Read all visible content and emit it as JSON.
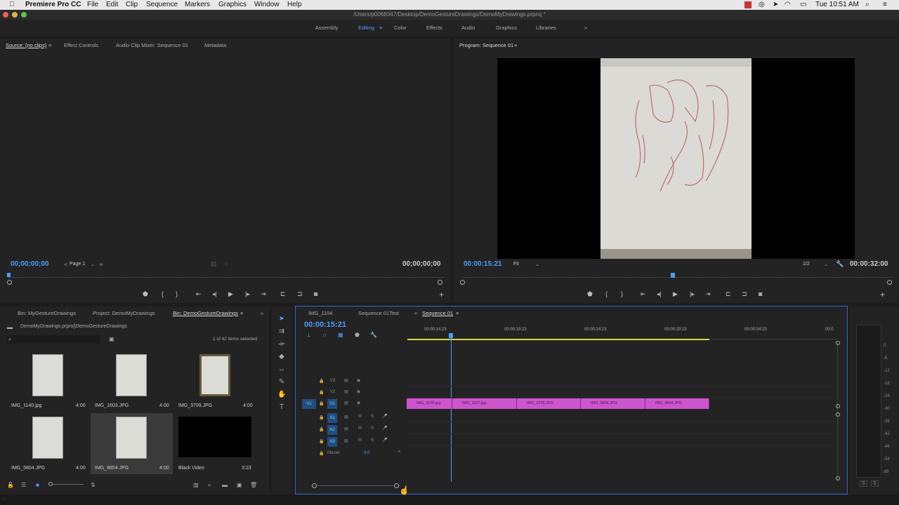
{
  "menubar": {
    "app": "Premiere Pro CC",
    "items": [
      "File",
      "Edit",
      "Clip",
      "Sequence",
      "Markers",
      "Graphics",
      "Window",
      "Help"
    ],
    "clock": "Tue 10:51 AM"
  },
  "titlebar": {
    "path": "/Users/p0068347/Desktop/DemoGestureDrawings/DemoMyDrawings.prproj *"
  },
  "workspaces": [
    "Assembly",
    "Editing",
    "Color",
    "Effects",
    "Audio",
    "Graphics",
    "Libraries"
  ],
  "source": {
    "tabs": [
      "Source: (no clips)",
      "Effect Controls",
      "Audio Clip Mixer: Sequence 01",
      "Metadata"
    ],
    "timecode_in": "00;00;00;00",
    "page": "Page 1",
    "timecode_out": "00;00;00;00"
  },
  "program": {
    "title": "Program: Sequence 01",
    "timecode": "00:00:15:21",
    "fit": "Fit",
    "resolution": "1/2",
    "duration": "00:00:32:00"
  },
  "project": {
    "tabs": [
      "Bin: MyGestureDrawings",
      "Project: DemoMyDrawings",
      "Bin: DemoGestureDrawings"
    ],
    "path": "DemoMyDrawings.prproj\\DemoGestureDrawings",
    "selection": "1 of 42 items selected",
    "items": [
      {
        "name": "IMG_1140.jpg",
        "dur": "4:00"
      },
      {
        "name": "IMG_1603.JPG",
        "dur": "4:00"
      },
      {
        "name": "IMG_3709.JPG",
        "dur": "4:00"
      },
      {
        "name": "IMG_5804.JPG",
        "dur": "4:00"
      },
      {
        "name": "IMG_8854.JPG",
        "dur": "4:00"
      },
      {
        "name": "Black Video",
        "dur": "3:23"
      }
    ]
  },
  "timeline": {
    "tabs": [
      "IMG_1104",
      "Sequence 01Test",
      "Sequence 01"
    ],
    "timecode": "00:00:15:21",
    "ruler": [
      "00:00:14:23",
      "00:00:19:23",
      "00:00:24:23",
      "00:00:29:23",
      "00:00:34:23",
      "00:0"
    ],
    "tracks": {
      "v3": "V3",
      "v2": "V2",
      "v1": "V1",
      "a1": "A1",
      "a2": "A2",
      "a3": "A3",
      "master": "Master",
      "master_val": "0.0",
      "src_v1": "V1",
      "m": "M",
      "s": "S"
    },
    "clips": [
      "IMG_1106.jpg",
      "IMG_1107.jpg",
      "IMG_3709.JPG",
      "IMG_5804.JPG",
      "IMG_8854.JPG"
    ]
  },
  "meter": {
    "ticks": [
      "0",
      "-6",
      "-12",
      "-18",
      "-24",
      "-30",
      "-36",
      "-42",
      "-48",
      "-54",
      "dB"
    ],
    "solo": [
      "S",
      "S"
    ]
  }
}
